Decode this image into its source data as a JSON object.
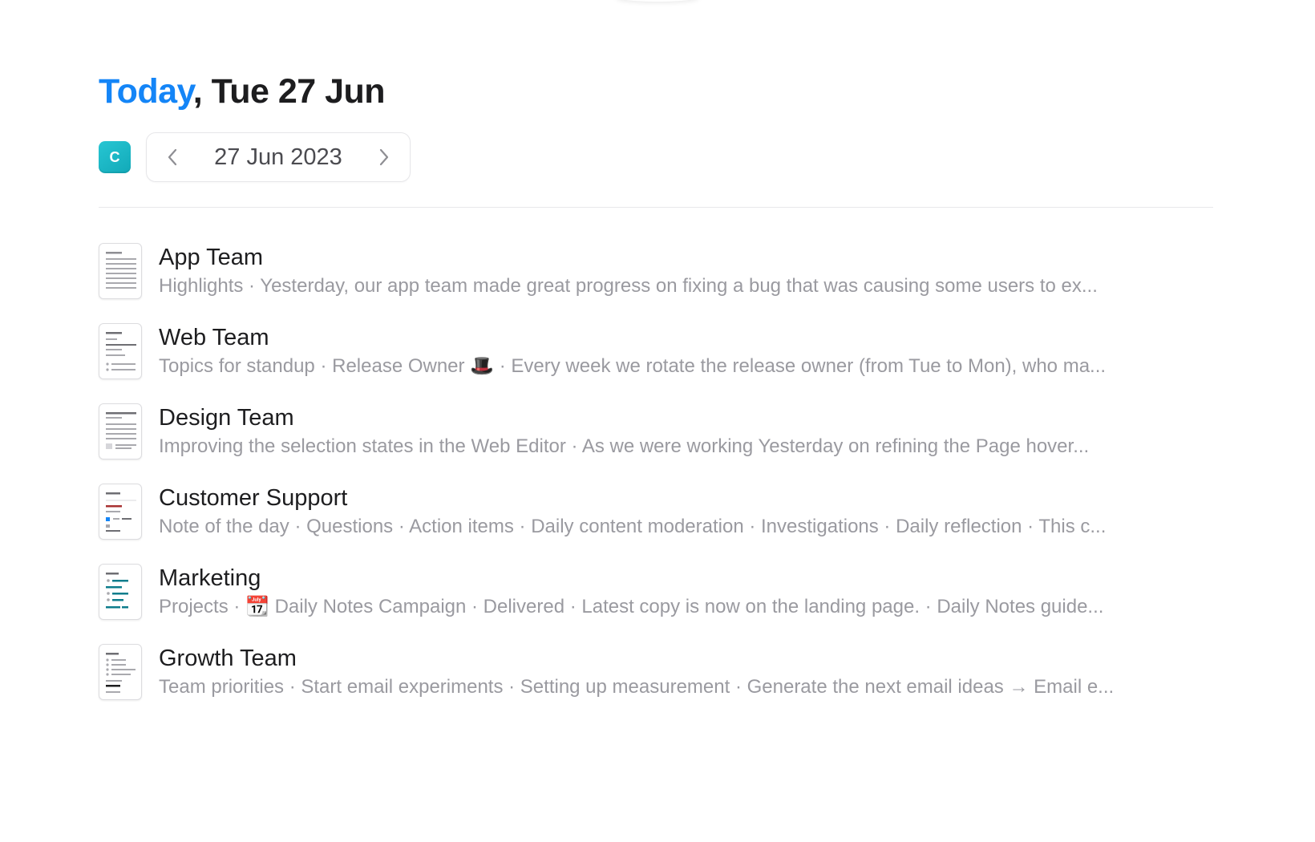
{
  "header": {
    "title_highlight": "Today",
    "title_rest": ", Tue 27 Jun"
  },
  "date_nav": {
    "avatar_letter": "C",
    "current_date": "27 Jun 2023",
    "prev_icon": "chevron-left-icon",
    "next_icon": "chevron-right-icon"
  },
  "colors": {
    "accent": "#1485f7",
    "avatar": "#1fb8c6",
    "preview_text": "#9a9aa0"
  },
  "notes": [
    {
      "title": "App Team",
      "preview": "Highlights  · Yesterday, our app team made great progress on fixing a bug that was causing some users to ex...",
      "icon": "document-text-icon"
    },
    {
      "title": "Web Team",
      "preview": "Topics for standup · Release Owner 🎩 · Every week we rotate the release owner (from Tue to Mon), who ma...",
      "icon": "document-list-icon"
    },
    {
      "title": "Design Team",
      "preview": "Improving the selection states in the Web Editor  · As we were working Yesterday on refining the Page hover...",
      "icon": "document-image-icon"
    },
    {
      "title": "Customer Support",
      "preview": "Note of the day · Questions · Action items · Daily content moderation · Investigations · Daily reflection · This c...",
      "icon": "document-checklist-icon"
    },
    {
      "title": "Marketing",
      "preview": "Projects · 📆 Daily Notes Campaign · Delivered · Latest copy is now on the landing page. · Daily Notes guide...",
      "icon": "document-bullets-icon"
    },
    {
      "title": "Growth Team",
      "preview": "Team priorities · Start email experiments · Setting up measurement · Generate the next email ideas → Email e...",
      "icon": "document-outline-icon"
    }
  ]
}
